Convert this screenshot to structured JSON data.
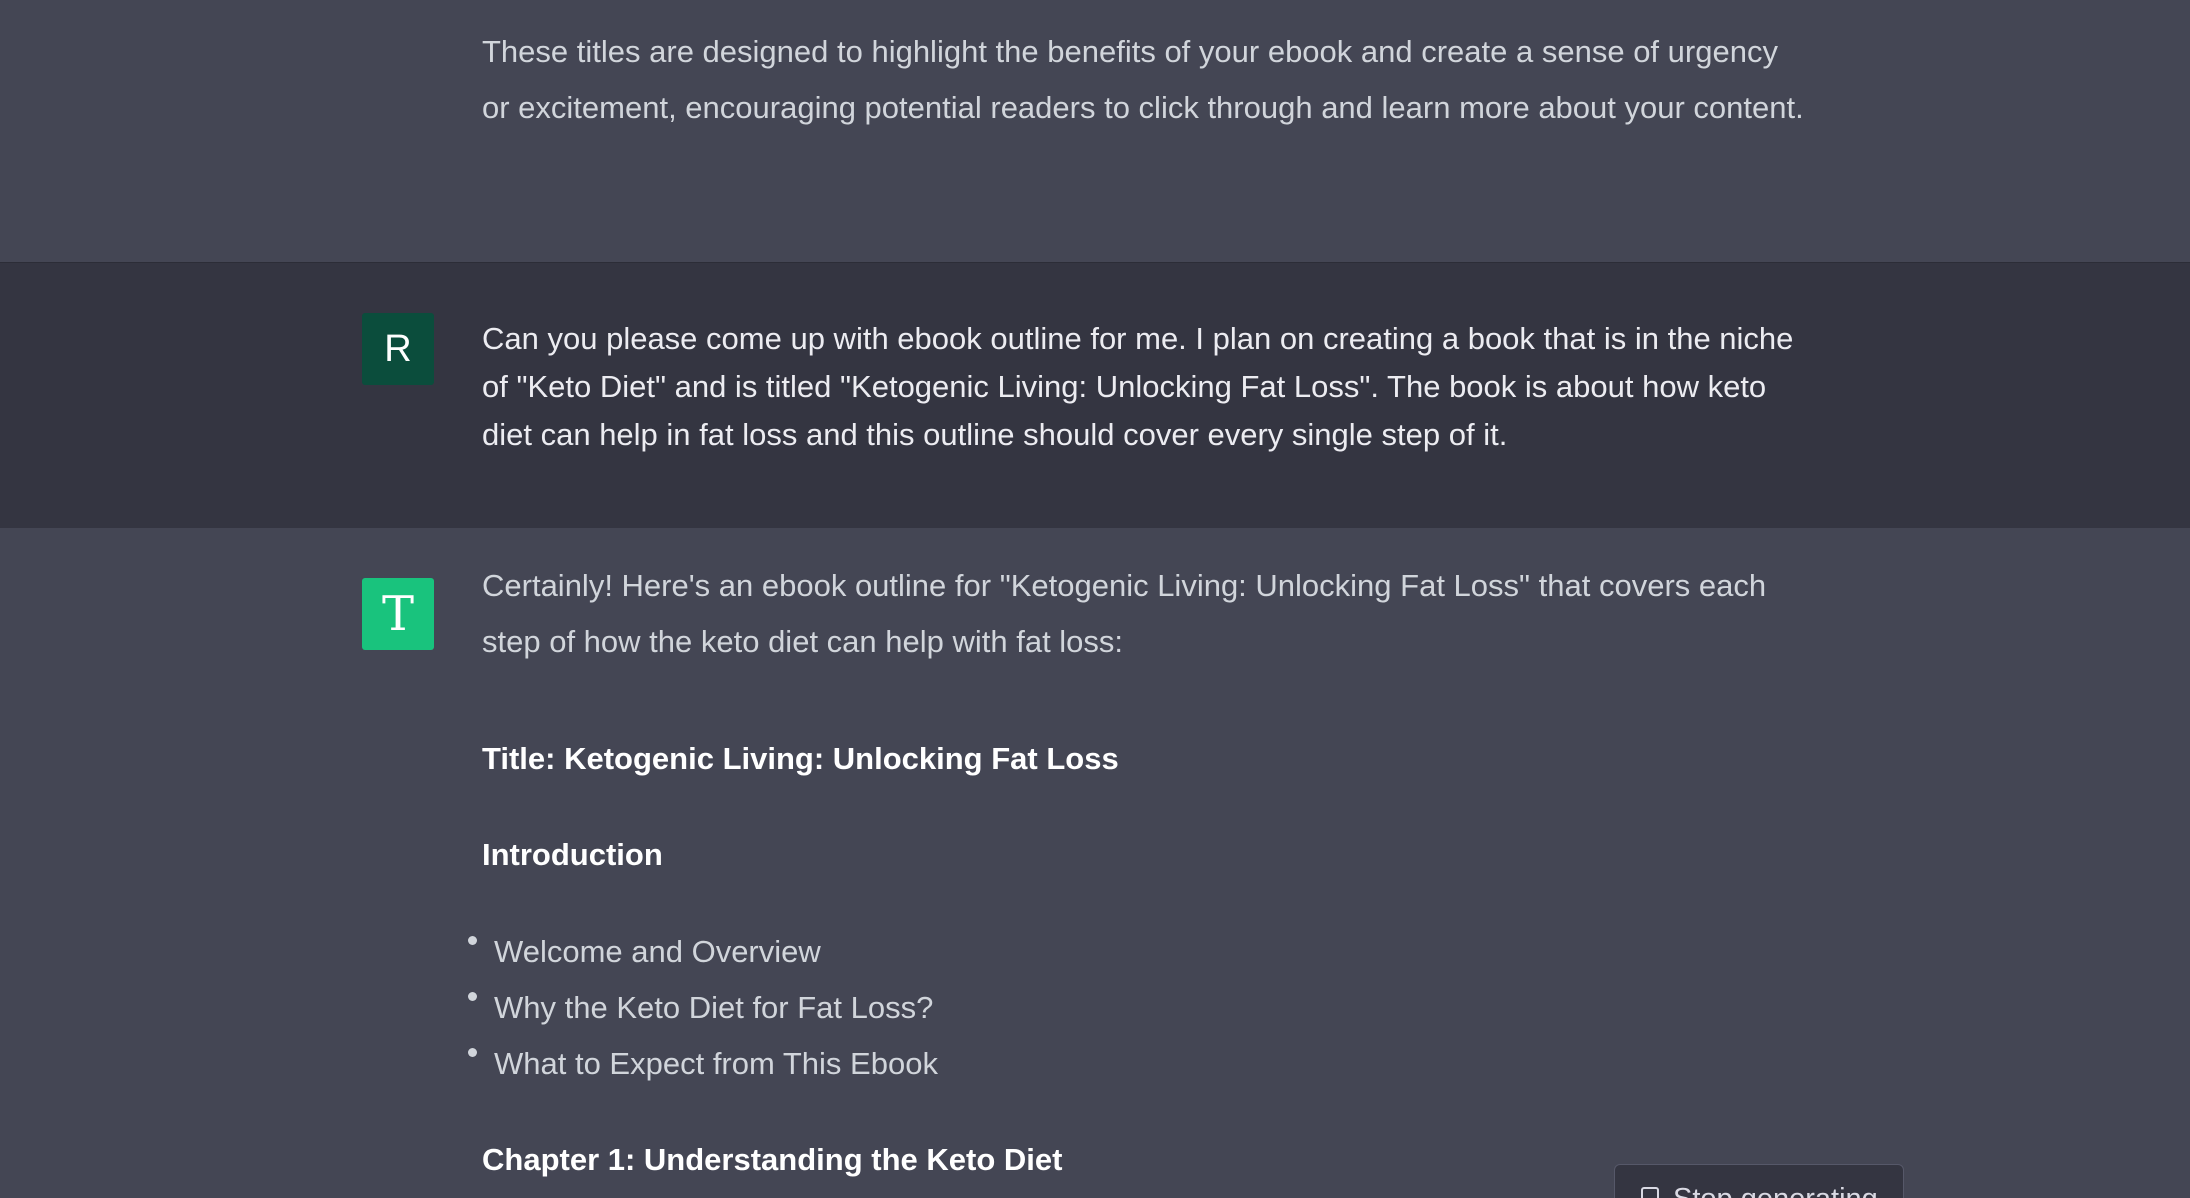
{
  "conversation": {
    "prev_assistant": {
      "text": "These titles are designed to highlight the benefits of your ebook and create a sense of urgency or excitement, encouraging potential readers to click through and learn more about your content."
    },
    "user_message": {
      "avatar_letter": "R",
      "text": "Can you please come up with ebook outline for me. I plan on creating a book that is in the niche of \"Keto Diet\" and is titled \"Ketogenic Living: Unlocking Fat Loss\". The book is about how keto diet can help in fat loss and this outline should cover every single step of it."
    },
    "assistant_message": {
      "avatar_letter": "T",
      "intro": "Certainly! Here's an ebook outline for \"Ketogenic Living: Unlocking Fat Loss\" that covers each step of how the keto diet can help with fat loss:",
      "title_line": "Title: Ketogenic Living: Unlocking Fat Loss",
      "introduction_heading": "Introduction",
      "introduction_items": [
        "Welcome and Overview",
        "Why the Keto Diet for Fat Loss?",
        "What to Expect from This Ebook"
      ],
      "chapter1_heading": "Chapter 1: Understanding the Keto Diet"
    }
  },
  "controls": {
    "stop_button_label": "Stop generating"
  },
  "colors": {
    "assistant_bg": "#444654",
    "user_bg": "#343541",
    "user_avatar": "#0b4d3c",
    "bot_avatar": "#19c37d"
  }
}
